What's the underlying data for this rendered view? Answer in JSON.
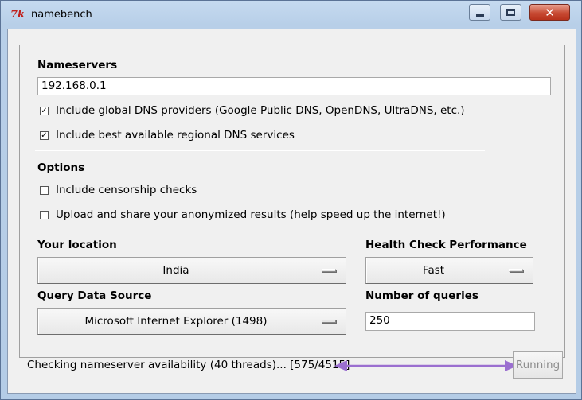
{
  "window": {
    "title": "namebench",
    "icon_text": "7k",
    "controls": {
      "minimize": "minimize",
      "maximize": "maximize",
      "close": "✕"
    }
  },
  "nameservers": {
    "heading": "Nameservers",
    "value": "192.168.0.1",
    "include_global": {
      "label": "Include global DNS providers (Google Public DNS, OpenDNS, UltraDNS, etc.)",
      "checked": true
    },
    "include_regional": {
      "label": "Include best available regional DNS services",
      "checked": true
    }
  },
  "options": {
    "heading": "Options",
    "censorship": {
      "label": "Include censorship checks",
      "checked": false
    },
    "upload": {
      "label": "Upload and share your anonymized results (help speed up the internet!)",
      "checked": false
    }
  },
  "location": {
    "label": "Your location",
    "value": "India"
  },
  "health_check": {
    "label": "Health Check Performance",
    "value": "Fast"
  },
  "query_source": {
    "label": "Query Data Source",
    "value": "Microsoft Internet Explorer (1498)"
  },
  "num_queries": {
    "label": "Number of queries",
    "value": "250"
  },
  "status": {
    "text": "Checking nameserver availability (40 threads)... [575/4515]"
  },
  "run_button": {
    "label": "Running",
    "enabled": false
  },
  "colors": {
    "annotation_arrow": "#9b6fd0",
    "close_button": "#c74a33"
  }
}
